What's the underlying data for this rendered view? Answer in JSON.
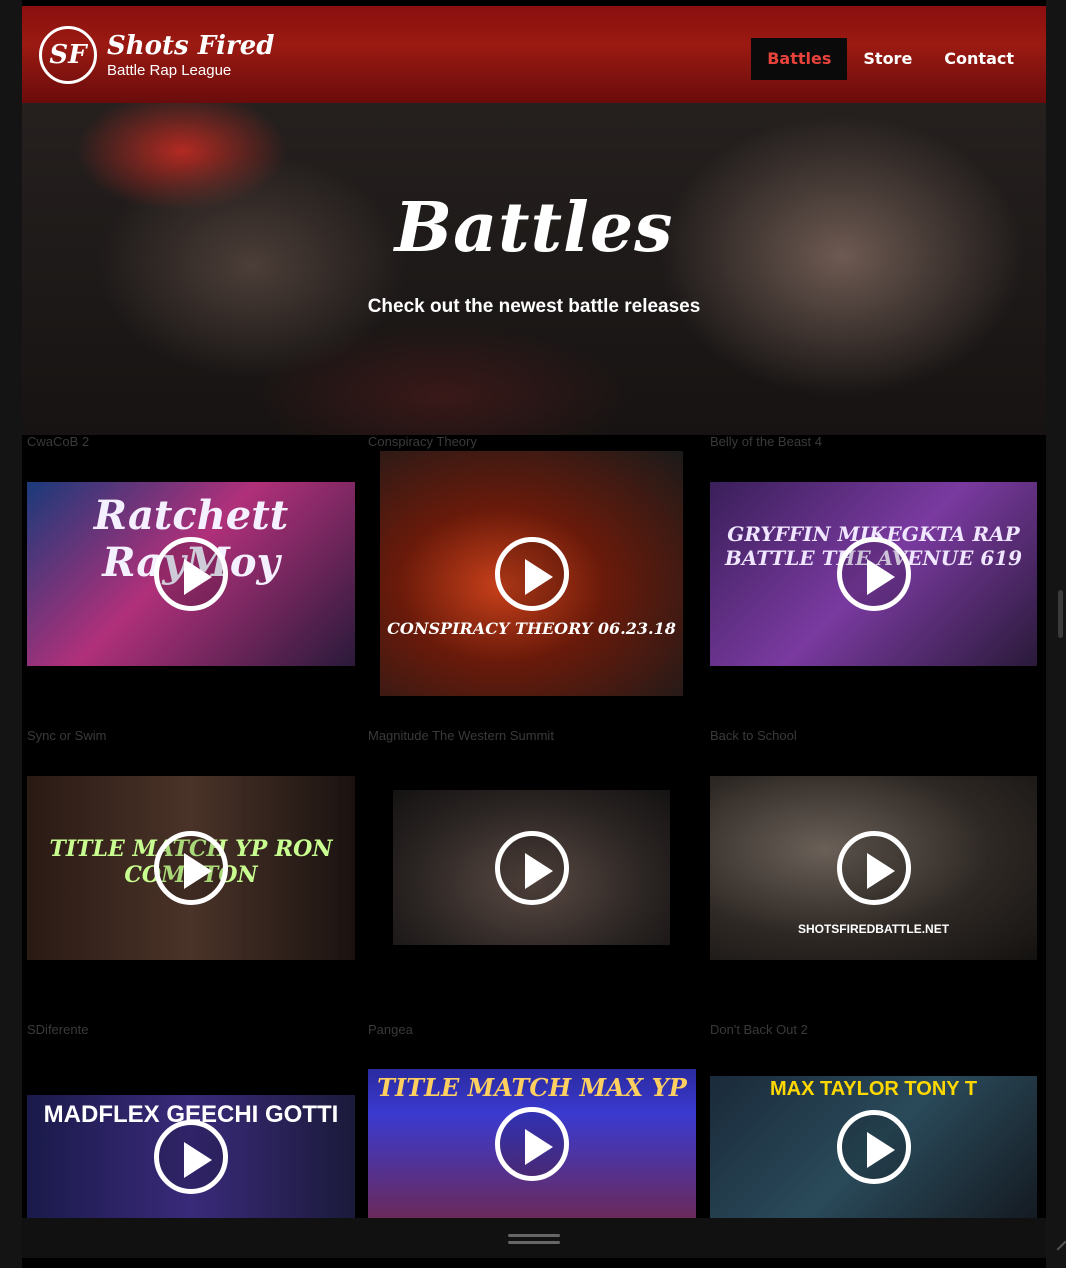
{
  "header": {
    "logo_badge": "SF",
    "logo_title": "Shots Fired",
    "logo_subtitle": "Battle Rap League",
    "nav": [
      "Battles",
      "Store",
      "Contact"
    ],
    "active_nav": "Battles"
  },
  "hero": {
    "title": "Battles",
    "subtitle": "Check out the newest battle releases"
  },
  "battles": [
    {
      "label": "CwaCoB 2",
      "thumb_text": "Ratchett RayMoy"
    },
    {
      "label": "Conspiracy Theory",
      "thumb_text": "CONSPIRACY THEORY 06.23.18"
    },
    {
      "label": "Belly of the Beast 4",
      "thumb_text": "GRYFFIN  MIKEGKTA  RAP BATTLE  THE AVENUE 619"
    },
    {
      "label": "Sync or Swim",
      "thumb_text": "TITLE MATCH  YP  RON COMPTON"
    },
    {
      "label": "Magnitude The Western Summit",
      "thumb_text": ""
    },
    {
      "label": "Back to School",
      "thumb_text": "SHOTSFIREDBATTLE.NET"
    },
    {
      "label": "SDiferente",
      "thumb_text": "MADFLEX  GEECHI GOTTI"
    },
    {
      "label": "Pangea",
      "thumb_text": "TITLE MATCH  MAX  YP"
    },
    {
      "label": "Don't Back Out 2",
      "thumb_text": "MAX TAYLOR  TONY T"
    }
  ],
  "colors": {
    "nav_red": "#8a0f0f",
    "active_text": "#e8423a"
  }
}
